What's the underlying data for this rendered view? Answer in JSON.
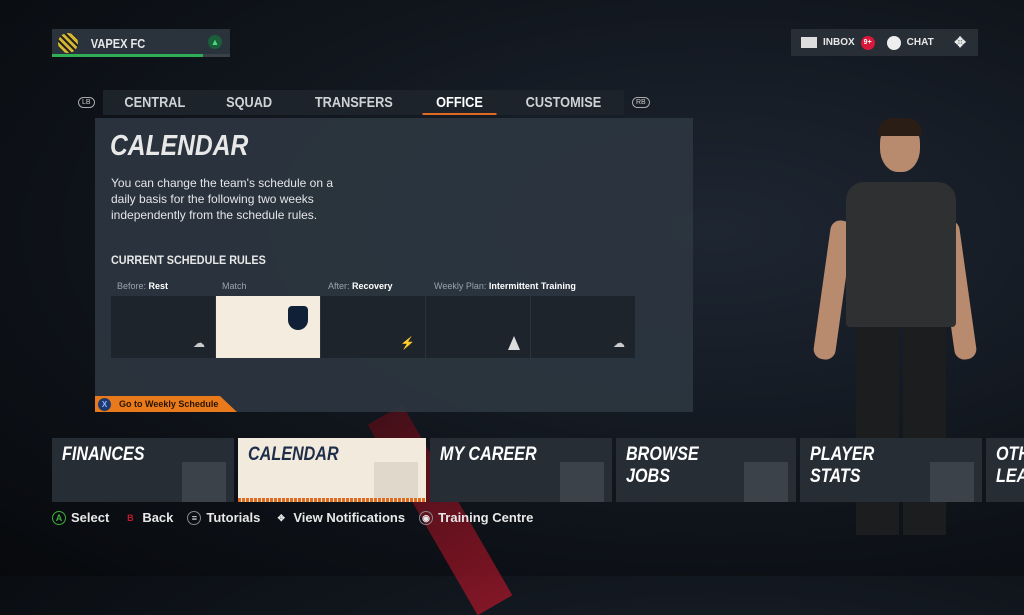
{
  "club": {
    "name": "VAPEX FC",
    "progress": 0.85
  },
  "topbar": {
    "inbox_label": "INBOX",
    "inbox_count": "9+",
    "chat_label": "CHAT"
  },
  "nav": {
    "left_bumper": "LB",
    "right_bumper": "RB",
    "tabs": [
      "CENTRAL",
      "SQUAD",
      "TRANSFERS",
      "OFFICE",
      "CUSTOMISE"
    ],
    "active": "OFFICE"
  },
  "panel": {
    "title": "CALENDAR",
    "description": "You can change the team's schedule on a daily basis for the following two weeks independently from the schedule rules.",
    "rules_heading": "CURRENT SCHEDULE RULES",
    "labels": [
      {
        "prefix": "Before:",
        "value": "Rest"
      },
      {
        "prefix": "Match",
        "value": ""
      },
      {
        "prefix": "After:",
        "value": "Recovery"
      },
      {
        "prefix": "Weekly Plan:",
        "value": "Intermittent Training"
      }
    ],
    "days": [
      {
        "icon": "rest-icon"
      },
      {
        "icon": "club-crest-icon"
      },
      {
        "icon": "recovery-icon"
      },
      {
        "icon": "training-cone-icon"
      },
      {
        "icon": "rest-icon"
      }
    ],
    "action_button": "X",
    "action_label": "Go to Weekly Schedule"
  },
  "cards": [
    {
      "label": "FINANCES"
    },
    {
      "label": "CALENDAR"
    },
    {
      "label": "MY CAREER"
    },
    {
      "label": "BROWSE JOBS"
    },
    {
      "label": "PLAYER STATS"
    },
    {
      "label": "OTH LEA"
    }
  ],
  "footer": [
    {
      "btn": "A",
      "label": "Select",
      "color": "#3fae3f"
    },
    {
      "btn": "B",
      "label": "Back",
      "color": "#c0182c"
    },
    {
      "btn": "≡",
      "label": "Tutorials",
      "color": "#bbbbbb"
    },
    {
      "btn": "✥",
      "label": "View Notifications",
      "color": "#bbbbbb"
    },
    {
      "btn": "◉",
      "label": "Training Centre",
      "color": "#bbbbbb"
    }
  ],
  "colors": {
    "accent": "#e06a20",
    "selected_card": "#f2ebdd",
    "panel": "#2c3640"
  }
}
